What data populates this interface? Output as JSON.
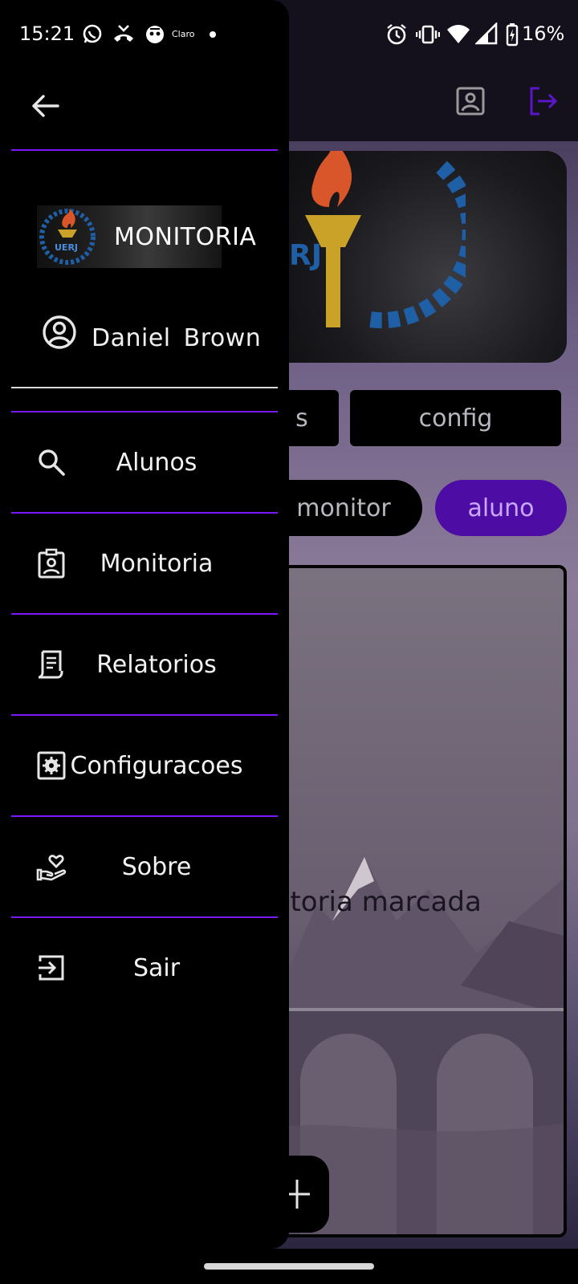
{
  "status_bar": {
    "time": "15:21",
    "carrier_label": "Claro",
    "battery": "16%"
  },
  "drawer": {
    "logo_text": "MONITORIA",
    "user_name": "Daniel  Brown",
    "menu": [
      {
        "label": "Alunos",
        "icon": "search-icon"
      },
      {
        "label": "Monitoria",
        "icon": "badge-icon"
      },
      {
        "label": "Relatorios",
        "icon": "report-icon"
      },
      {
        "label": "Configuracoes",
        "icon": "settings-icon"
      },
      {
        "label": "Sobre",
        "icon": "heart-hand-icon"
      },
      {
        "label": "Sair",
        "icon": "login-icon"
      }
    ],
    "accent_color": "#7a18ff"
  },
  "app": {
    "buttons": {
      "partial": "s",
      "config": "config",
      "monitor": "monitor",
      "aluno": "aluno"
    },
    "card_text": "itoria marcada",
    "accent_color": "#4d0ca3"
  }
}
